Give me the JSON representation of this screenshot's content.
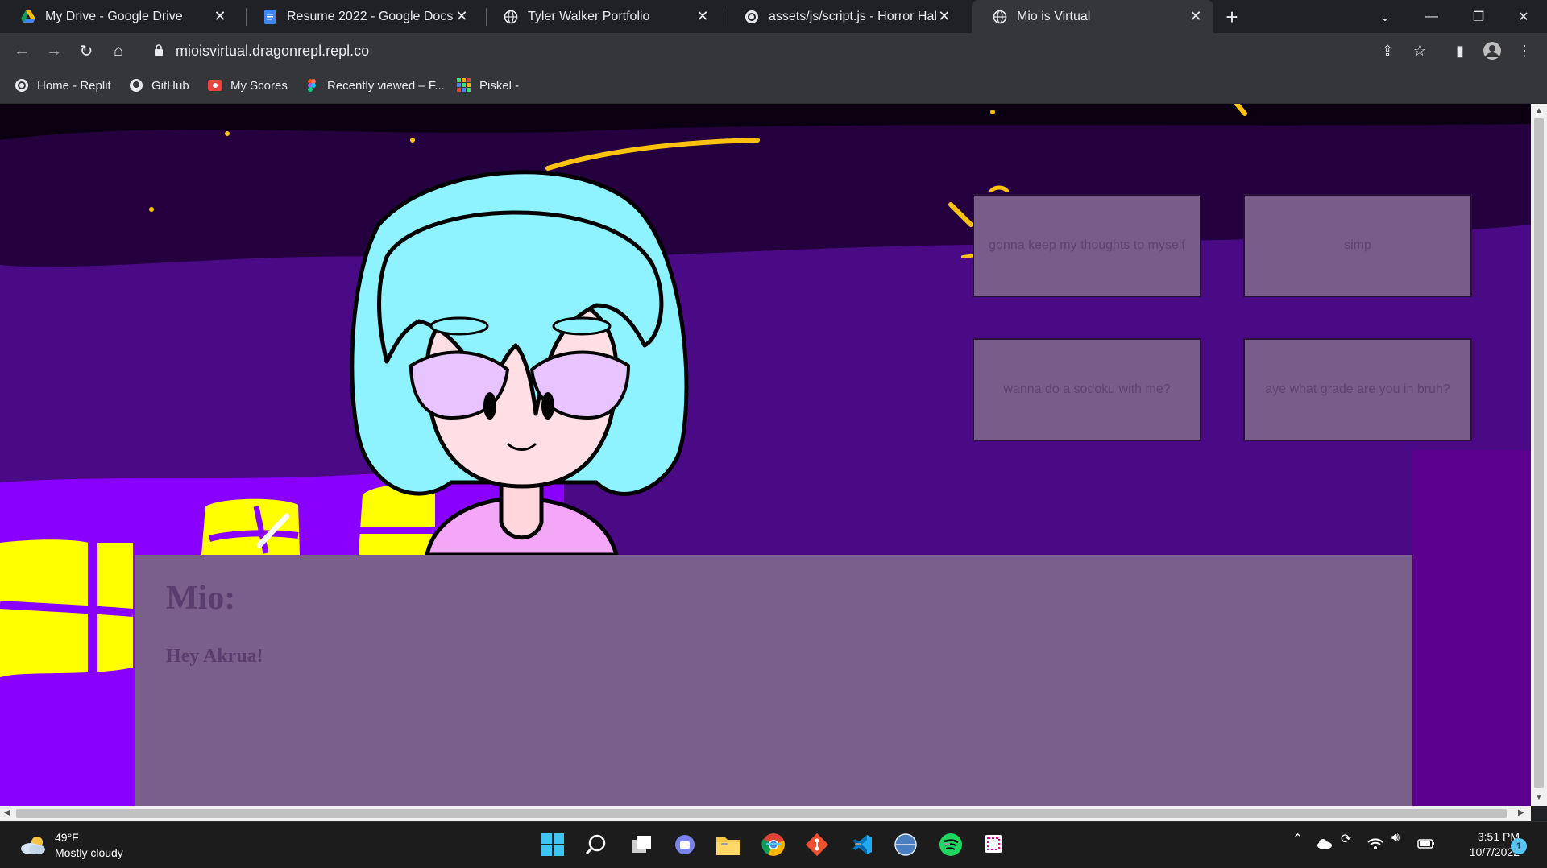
{
  "browser": {
    "tabs": [
      {
        "title": "My Drive - Google Drive",
        "icon": "google-drive-icon",
        "active": false
      },
      {
        "title": "Resume 2022 - Google Docs",
        "icon": "google-docs-icon",
        "active": false
      },
      {
        "title": "Tyler Walker Portfolio",
        "icon": "globe-icon",
        "active": false
      },
      {
        "title": "assets/js/script.js - Horror Hall - I",
        "icon": "replit-icon",
        "active": false
      },
      {
        "title": "Mio is Virtual",
        "icon": "globe-icon",
        "active": true
      }
    ],
    "url": "mioisvirtual.dragonrepl.repl.co",
    "bookmarks": [
      {
        "label": "Home - Replit",
        "icon": "replit-icon"
      },
      {
        "label": "GitHub",
        "icon": "github-icon"
      },
      {
        "label": "My Scores",
        "icon": "scores-icon"
      },
      {
        "label": "Recently viewed – F...",
        "icon": "figma-icon"
      },
      {
        "label": "Piskel -",
        "icon": "piskel-icon"
      }
    ]
  },
  "page": {
    "choices": [
      "gonna keep my thoughts to myself",
      "simp",
      "wanna do a sodoku with me?",
      "aye what grade are you in bruh?"
    ],
    "dialog": {
      "speaker": "Mio:",
      "text": "Hey Akrua!"
    },
    "colors": {
      "sky": "#2b0046",
      "room": "#4a0a86",
      "floor": "#8a00ff",
      "gift": "#ffff00",
      "hair": "#8ef3ff",
      "choice_bg": "#7a5c8b",
      "dialog_bg": "#7a5f8c"
    }
  },
  "taskbar": {
    "weather_temp": "49°F",
    "weather_desc": "Mostly cloudy",
    "time": "3:51 PM",
    "date": "10/7/2022",
    "notifications": "1"
  }
}
